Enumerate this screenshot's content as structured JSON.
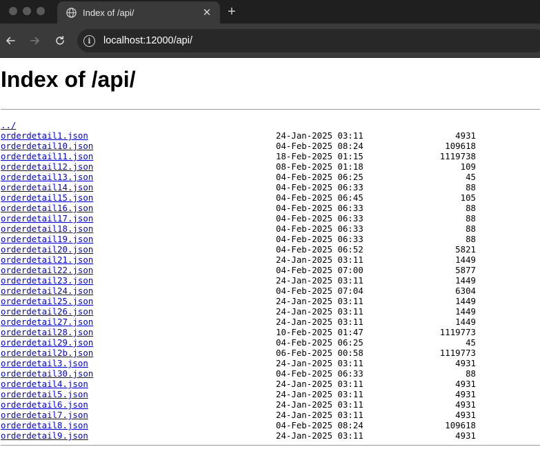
{
  "browser": {
    "tab_title": "Index of /api/",
    "url_host": "localhost",
    "url_rest": ":12000/api/",
    "colors": {
      "chrome_dark": "#1f1f1f",
      "toolbar": "#3a3a3a",
      "omnibox": "#282828"
    }
  },
  "page": {
    "heading": "Index of /api/",
    "parent_link": "../",
    "link_color": "#0000ee",
    "entries": [
      {
        "name": "orderdetail1.json",
        "date": "24-Jan-2025 03:11",
        "size": "4931"
      },
      {
        "name": "orderdetail10.json",
        "date": "04-Feb-2025 08:24",
        "size": "109618"
      },
      {
        "name": "orderdetail11.json",
        "date": "18-Feb-2025 01:15",
        "size": "1119738"
      },
      {
        "name": "orderdetail12.json",
        "date": "08-Feb-2025 01:18",
        "size": "109"
      },
      {
        "name": "orderdetail13.json",
        "date": "04-Feb-2025 06:25",
        "size": "45"
      },
      {
        "name": "orderdetail14.json",
        "date": "04-Feb-2025 06:33",
        "size": "88"
      },
      {
        "name": "orderdetail15.json",
        "date": "04-Feb-2025 06:45",
        "size": "105"
      },
      {
        "name": "orderdetail16.json",
        "date": "04-Feb-2025 06:33",
        "size": "88"
      },
      {
        "name": "orderdetail17.json",
        "date": "04-Feb-2025 06:33",
        "size": "88"
      },
      {
        "name": "orderdetail18.json",
        "date": "04-Feb-2025 06:33",
        "size": "88"
      },
      {
        "name": "orderdetail19.json",
        "date": "04-Feb-2025 06:33",
        "size": "88"
      },
      {
        "name": "orderdetail20.json",
        "date": "04-Feb-2025 06:52",
        "size": "5821"
      },
      {
        "name": "orderdetail21.json",
        "date": "24-Jan-2025 03:11",
        "size": "1449"
      },
      {
        "name": "orderdetail22.json",
        "date": "04-Feb-2025 07:00",
        "size": "5877"
      },
      {
        "name": "orderdetail23.json",
        "date": "24-Jan-2025 03:11",
        "size": "1449"
      },
      {
        "name": "orderdetail24.json",
        "date": "04-Feb-2025 07:04",
        "size": "6304"
      },
      {
        "name": "orderdetail25.json",
        "date": "24-Jan-2025 03:11",
        "size": "1449"
      },
      {
        "name": "orderdetail26.json",
        "date": "24-Jan-2025 03:11",
        "size": "1449"
      },
      {
        "name": "orderdetail27.json",
        "date": "24-Jan-2025 03:11",
        "size": "1449"
      },
      {
        "name": "orderdetail28.json",
        "date": "10-Feb-2025 01:47",
        "size": "1119773"
      },
      {
        "name": "orderdetail29.json",
        "date": "04-Feb-2025 06:25",
        "size": "45"
      },
      {
        "name": "orderdetail2b.json",
        "date": "06-Feb-2025 00:58",
        "size": "1119773"
      },
      {
        "name": "orderdetail3.json",
        "date": "24-Jan-2025 03:11",
        "size": "4931"
      },
      {
        "name": "orderdetail30.json",
        "date": "04-Feb-2025 06:33",
        "size": "88"
      },
      {
        "name": "orderdetail4.json",
        "date": "24-Jan-2025 03:11",
        "size": "4931"
      },
      {
        "name": "orderdetail5.json",
        "date": "24-Jan-2025 03:11",
        "size": "4931"
      },
      {
        "name": "orderdetail6.json",
        "date": "24-Jan-2025 03:11",
        "size": "4931"
      },
      {
        "name": "orderdetail7.json",
        "date": "24-Jan-2025 03:11",
        "size": "4931"
      },
      {
        "name": "orderdetail8.json",
        "date": "04-Feb-2025 08:24",
        "size": "109618"
      },
      {
        "name": "orderdetail9.json",
        "date": "24-Jan-2025 03:11",
        "size": "4931"
      }
    ]
  }
}
